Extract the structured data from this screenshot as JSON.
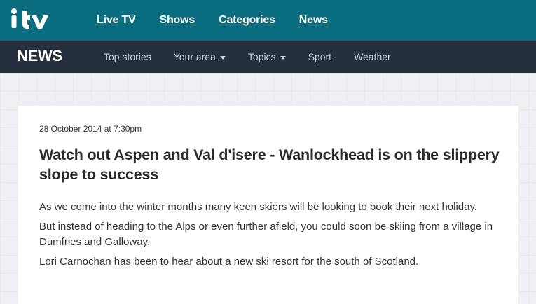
{
  "topnav": {
    "logo_text": "itv",
    "items": [
      "Live TV",
      "Shows",
      "Categories",
      "News"
    ]
  },
  "newsbar": {
    "brand": "NEWS",
    "items": [
      {
        "label": "Top stories",
        "dropdown": false
      },
      {
        "label": "Your area",
        "dropdown": true
      },
      {
        "label": "Topics",
        "dropdown": true
      },
      {
        "label": "Sport",
        "dropdown": false
      },
      {
        "label": "Weather",
        "dropdown": false
      }
    ]
  },
  "article": {
    "date": "28 October 2014 at 7:30pm",
    "headline": "Watch out Aspen and Val d'isere - Wanlockhead is on the slippery slope to success",
    "paragraphs": [
      "As we come into the winter months many keen skiers will be looking to book their next holiday.",
      "But instead of heading to the Alps or even further afield, you could soon be skiing from a village in Dumfries and Galloway.",
      "Lori Carnochan has been to hear about a new ski resort for the south of Scotland."
    ]
  },
  "colors": {
    "topbar": "#0a6e80",
    "newsbar": "#262f3d",
    "page_bg": "#eef0f3"
  }
}
